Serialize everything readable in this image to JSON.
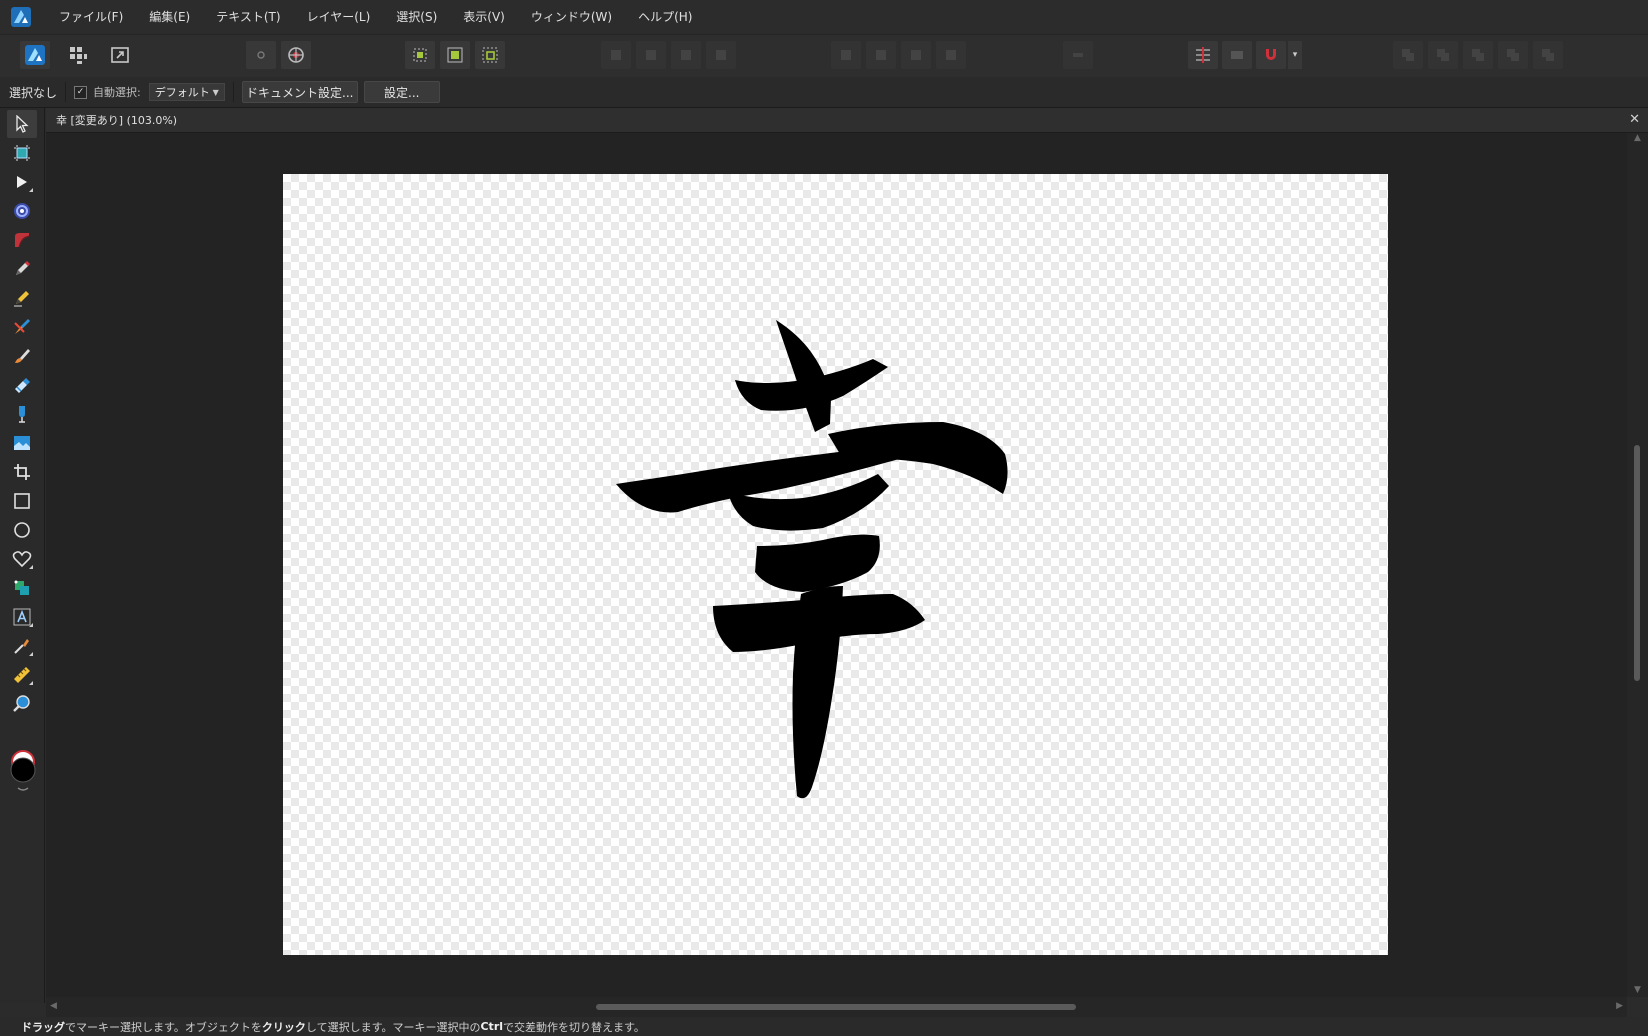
{
  "menu": {
    "items": [
      "ファイル(F)",
      "編集(E)",
      "テキスト(T)",
      "レイヤー(L)",
      "選択(S)",
      "表示(V)",
      "ウィンドウ(W)",
      "ヘルプ(H)"
    ]
  },
  "toolbar": {
    "personas": [
      "designer-persona-icon",
      "pixel-persona-icon",
      "export-persona-icon"
    ],
    "groups": [
      "view-mode-icons",
      "transform-icons",
      "arrange-icons",
      "align-icons",
      "snapping-icons",
      "boolean-icons"
    ]
  },
  "context": {
    "selection_status": "選択なし",
    "auto_select_checked": true,
    "auto_select_label": "自動選択:",
    "auto_select_value": "デフォルト",
    "document_setup_label": "ドキュメント設定...",
    "settings_label": "設定..."
  },
  "tools": [
    {
      "name": "move-tool-icon",
      "active": true
    },
    {
      "name": "artboard-tool-icon"
    },
    {
      "name": "node-tool-icon"
    },
    {
      "name": "corner-tool-icon"
    },
    {
      "name": "pen-tool-icon"
    },
    {
      "name": "pencil-tool-icon"
    },
    {
      "name": "vector-brush-tool-icon"
    },
    {
      "name": "paint-brush-tool-icon"
    },
    {
      "name": "pixel-tool-icon"
    },
    {
      "name": "fill-tool-icon"
    },
    {
      "name": "transparency-tool-icon"
    },
    {
      "name": "place-image-tool-icon"
    },
    {
      "name": "crop-tool-icon"
    },
    {
      "name": "rectangle-tool-icon"
    },
    {
      "name": "ellipse-tool-icon"
    },
    {
      "name": "heart-shape-tool-icon"
    },
    {
      "name": "shape-builder-tool-icon"
    },
    {
      "name": "text-tool-icon"
    },
    {
      "name": "color-picker-tool-icon"
    },
    {
      "name": "measure-tool-icon"
    },
    {
      "name": "zoom-tool-icon"
    }
  ],
  "colors": {
    "fill": "#000000",
    "stroke": "#ffffff",
    "accent": "#2a8fd6",
    "snapping": "#d0303a"
  },
  "document": {
    "tab_title": "幸 [変更あり] (103.0%)",
    "zoom": "103.0%",
    "artwork": "幸"
  },
  "status": {
    "parts": [
      {
        "text": "ドラッグ",
        "bold": true
      },
      {
        "text": "でマーキー選択します。オブジェクトを",
        "bold": false
      },
      {
        "text": "クリック",
        "bold": true
      },
      {
        "text": "して選択します。マーキー選択中の",
        "bold": false
      },
      {
        "text": "Ctrl",
        "bold": true
      },
      {
        "text": "で交差動作を切り替えます。",
        "bold": false
      }
    ]
  }
}
